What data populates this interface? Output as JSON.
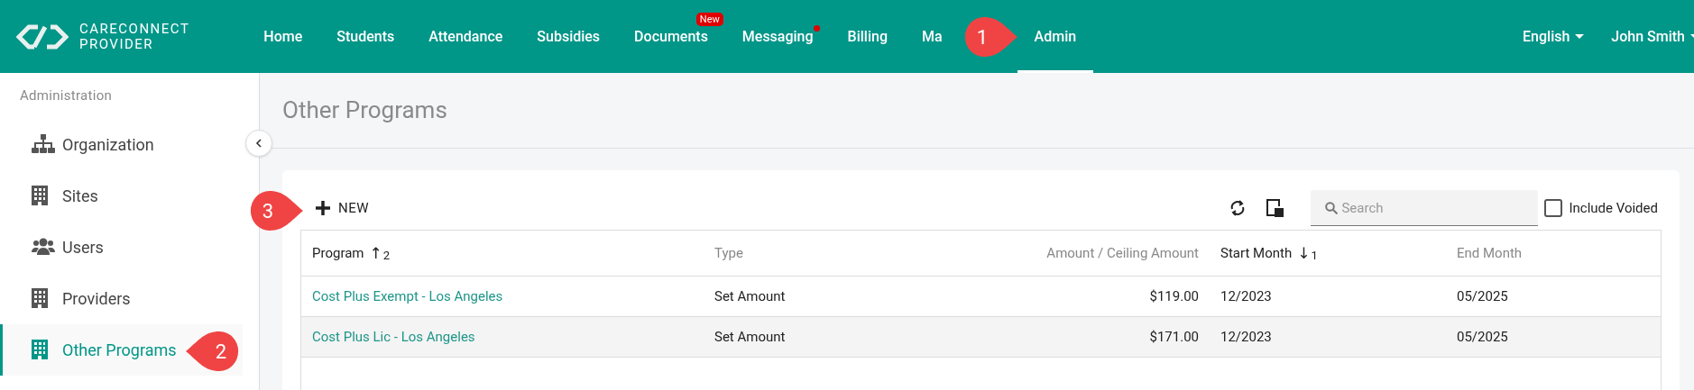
{
  "header": {
    "logo": {
      "line1": "CARECONNECT",
      "line2": "PROVIDER"
    },
    "nav": [
      {
        "label": "Home",
        "selected": false
      },
      {
        "label": "Students",
        "selected": false
      },
      {
        "label": "Attendance",
        "selected": false
      },
      {
        "label": "Subsidies",
        "selected": false
      },
      {
        "label": "Documents",
        "selected": false,
        "badge": "New"
      },
      {
        "label": "Messaging",
        "selected": false,
        "dot": true
      },
      {
        "label": "Billing",
        "selected": false
      },
      {
        "label": "Ma",
        "selected": false
      },
      {
        "label": "Admin",
        "selected": true
      }
    ],
    "language": "English",
    "user": "John Smith"
  },
  "sidebar": {
    "heading": "Administration",
    "items": [
      {
        "label": "Organization",
        "selected": false
      },
      {
        "label": "Sites",
        "selected": false
      },
      {
        "label": "Users",
        "selected": false
      },
      {
        "label": "Providers",
        "selected": false
      },
      {
        "label": "Other Programs",
        "selected": true
      }
    ]
  },
  "page": {
    "title": "Other Programs"
  },
  "toolbar": {
    "new_button": "NEW",
    "search": {
      "placeholder": "Search"
    },
    "include_voided": {
      "label": "Include Voided",
      "checked": false
    }
  },
  "table": {
    "columns": [
      {
        "label": "Program",
        "sort_arrow": "↑",
        "sort_order": "2"
      },
      {
        "label": "Type"
      },
      {
        "label": "Amount / Ceiling Amount"
      },
      {
        "label": "Start Month",
        "sort_arrow": "↓",
        "sort_order": "1"
      },
      {
        "label": "End Month"
      }
    ],
    "rows": [
      {
        "cells": [
          "Cost Plus Exempt - Los Angeles",
          "Set Amount",
          "$119.00",
          "12/2023",
          "05/2025"
        ]
      },
      {
        "cells": [
          "Cost Plus Lic - Los Angeles",
          "Set Amount",
          "$171.00",
          "12/2023",
          "05/2025"
        ]
      }
    ]
  },
  "callouts": [
    {
      "label": "1"
    },
    {
      "label": "2"
    },
    {
      "label": "3"
    }
  ]
}
